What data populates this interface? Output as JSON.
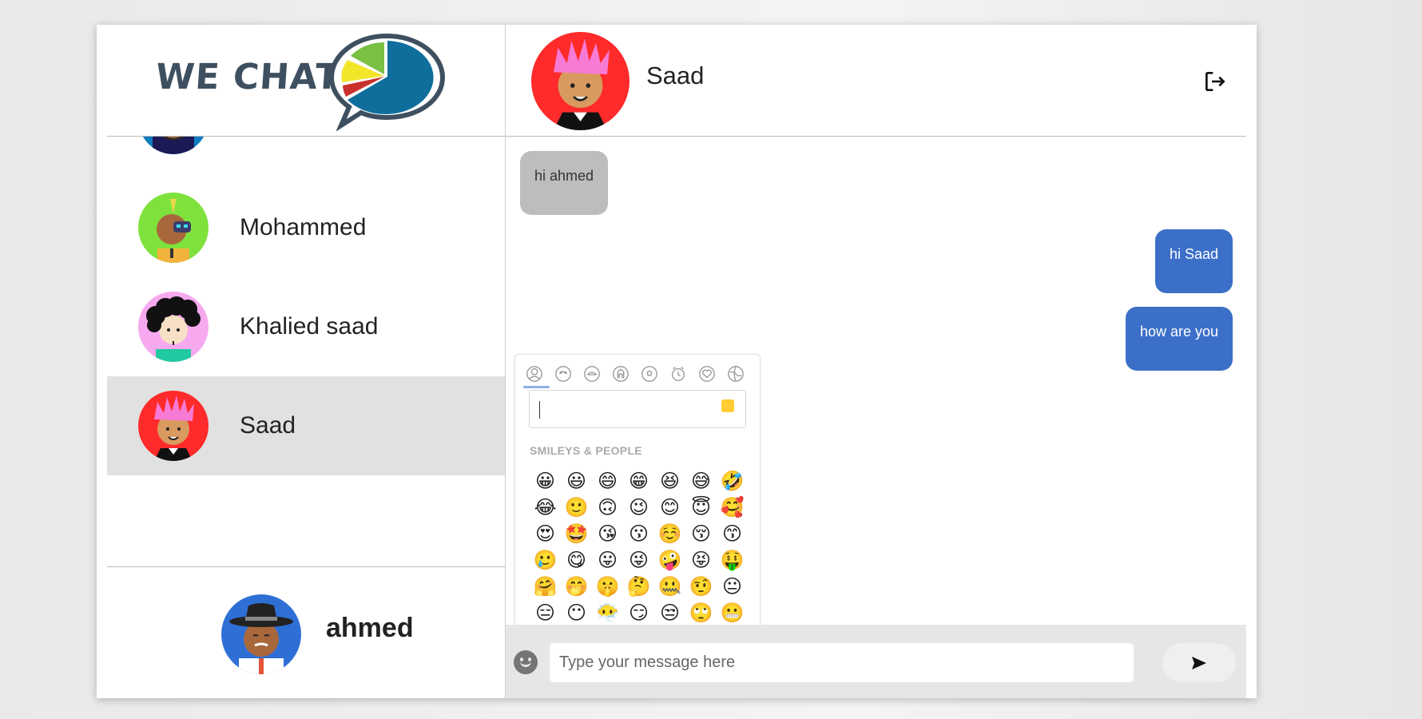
{
  "app": {
    "logo_text": "WE CHAT"
  },
  "contacts": [
    {
      "name": "",
      "avatar_bg": "#0f7cc0"
    },
    {
      "name": "Mohammed",
      "avatar_bg": "#7fe23c"
    },
    {
      "name": "Khalied saad",
      "avatar_bg": "#f7a9ef"
    },
    {
      "name": "Saad",
      "avatar_bg": "#ff2a2a",
      "active": true
    }
  ],
  "current_user": {
    "name": "ahmed",
    "avatar_bg": "#2e6fd6"
  },
  "chat": {
    "recipient": "Saad",
    "messages": [
      {
        "text": "hi ahmed",
        "direction": "in"
      },
      {
        "text": "hi Saad",
        "direction": "out"
      },
      {
        "text": "how are you",
        "direction": "out"
      }
    ]
  },
  "emoji_picker": {
    "category_label": "SMILEYS & PEOPLE",
    "categories": [
      "people-icon",
      "nature-icon",
      "food-icon",
      "places-icon",
      "activity-icon",
      "objects-icon",
      "symbols-icon",
      "flags-icon"
    ],
    "emojis": [
      "😀",
      "😃",
      "😄",
      "😁",
      "😆",
      "😅",
      "🤣",
      "😂",
      "🙂",
      "🙃",
      "😉",
      "😊",
      "😇",
      "🥰",
      "😍",
      "🤩",
      "😘",
      "😗",
      "☺️",
      "😚",
      "😙",
      "🥲",
      "😋",
      "😛",
      "😜",
      "🤪",
      "😝",
      "🤑",
      "🤗",
      "🤭",
      "🤫",
      "🤔",
      "🤐",
      "🤨",
      "😐",
      "😑",
      "😶",
      "😶‍🌫️",
      "😏",
      "😒",
      "🙄",
      "😬"
    ]
  },
  "input": {
    "placeholder": "Type your message here"
  },
  "colors": {
    "outgoing": "#3c6fc8",
    "incoming": "#bdbdbd",
    "active_contact": "#e1e1e1"
  }
}
